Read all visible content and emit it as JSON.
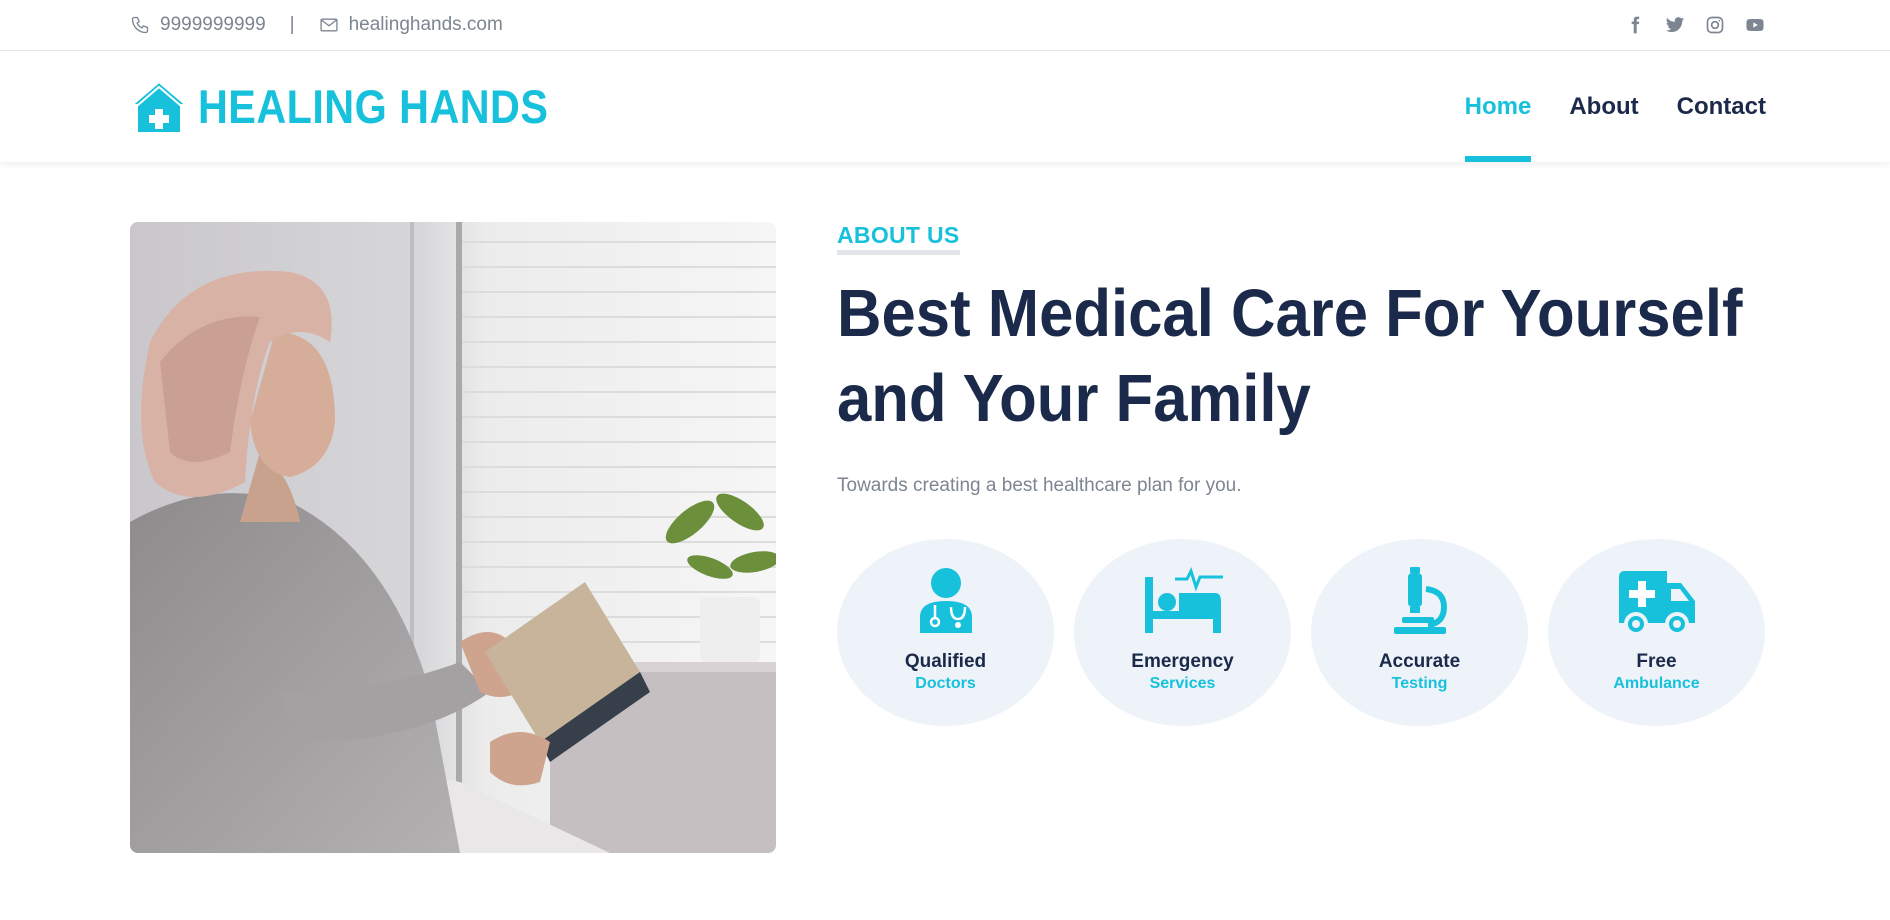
{
  "colors": {
    "accent": "#17c1dc",
    "navy": "#1b2a4a",
    "muted": "#7c8591",
    "feature_bg": "#edf3f8"
  },
  "topbar": {
    "phone": "9999999999",
    "separator": "|",
    "email": "healinghands.com",
    "social": [
      "facebook-icon",
      "twitter-icon",
      "instagram-icon",
      "youtube-icon"
    ]
  },
  "header": {
    "brand": "HEALING HANDS",
    "nav": [
      {
        "label": "Home",
        "active": true
      },
      {
        "label": "About",
        "active": false
      },
      {
        "label": "Contact",
        "active": false
      }
    ]
  },
  "about": {
    "eyebrow": "ABOUT US",
    "headline_line1": "Best Medical Care For Yourself",
    "headline_line2": "and Your Family",
    "subtitle": "Towards creating a best healthcare plan for you."
  },
  "features": [
    {
      "title": "Qualified",
      "subtitle": "Doctors",
      "icon": "doctor-icon"
    },
    {
      "title": "Emergency",
      "subtitle": "Services",
      "icon": "hospital-bed-icon"
    },
    {
      "title": "Accurate",
      "subtitle": "Testing",
      "icon": "microscope-icon"
    },
    {
      "title": "Free",
      "subtitle": "Ambulance",
      "icon": "ambulance-icon"
    }
  ]
}
